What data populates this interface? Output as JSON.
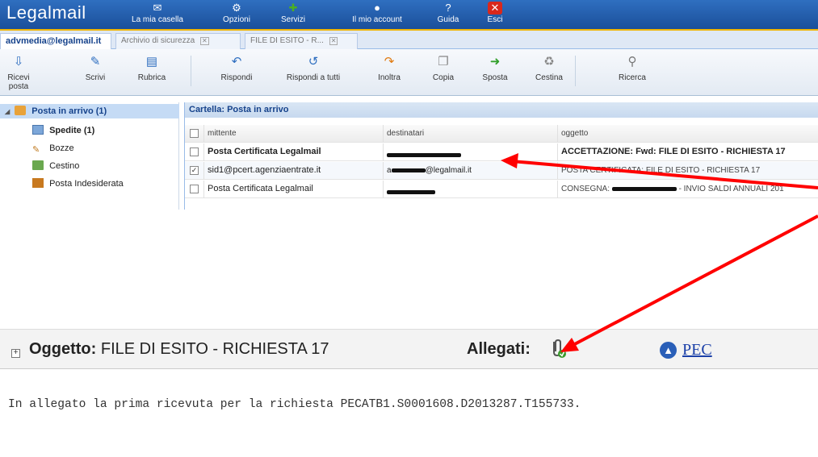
{
  "app": {
    "logo": "Legalmail"
  },
  "nav": [
    {
      "label": "La mia casella",
      "icon": "mailbox-icon"
    },
    {
      "label": "Opzioni",
      "icon": "gear-icon"
    },
    {
      "label": "Servizi",
      "icon": "puzzle-icon"
    },
    {
      "label": "Il mio account",
      "icon": "account-icon"
    },
    {
      "label": "Guida",
      "icon": "help-icon"
    },
    {
      "label": "Esci",
      "icon": "exit-icon"
    }
  ],
  "tabs": [
    {
      "label": "advmedia@legalmail.it",
      "active": true
    },
    {
      "label": "Archivio di sicurezza"
    },
    {
      "label": "FILE DI ESITO - R..."
    }
  ],
  "toolbar": [
    {
      "label": "Ricevi posta"
    },
    {
      "label": "Scrivi"
    },
    {
      "label": "Rubrica"
    },
    {
      "label": "Rispondi"
    },
    {
      "label": "Rispondi a tutti"
    },
    {
      "label": "Inoltra"
    },
    {
      "label": "Copia"
    },
    {
      "label": "Sposta"
    },
    {
      "label": "Cestina"
    },
    {
      "label": "Ricerca"
    }
  ],
  "folders": [
    {
      "label": "Posta in arrivo (1)",
      "selected": true
    },
    {
      "label": "Spedite (1)"
    },
    {
      "label": "Bozze"
    },
    {
      "label": "Cestino"
    },
    {
      "label": "Posta Indesiderata"
    }
  ],
  "grid": {
    "title": "Cartella: Posta in arrivo",
    "columns": [
      "mittente",
      "destinatari",
      "oggetto"
    ],
    "rows": [
      {
        "mittente": "Posta Certificata Legalmail",
        "destinatari": "",
        "oggetto": "ACCETTAZIONE: Fwd: FILE DI ESITO - RICHIESTA 17",
        "checked": false
      },
      {
        "mittente": "sid1@pcert.agenziaentrate.it",
        "destinatari_suffix": "@legalmail.it",
        "oggetto": "POSTA CERTIFICATA: FILE DI ESITO - RICHIESTA 17",
        "checked": true
      },
      {
        "mittente": "Posta Certificata Legalmail",
        "destinatari": "",
        "oggetto_prefix": "CONSEGNA:",
        "oggetto_suffix": "- INVIO SALDI ANNUALI 201",
        "checked": false
      }
    ]
  },
  "preview": {
    "subject_label": "Oggetto:",
    "subject_value": "FILE DI ESITO - RICHIESTA 17",
    "attachments_label": "Allegati:",
    "pec_label": "PEC",
    "body": "In allegato la prima ricevuta per la richiesta PECATB1.S0001608.D2013287.T155733."
  },
  "colors": {
    "brand_blue": "#1b4f9a",
    "accent_yellow": "#f0b400",
    "annotation_red": "#ff0000"
  }
}
